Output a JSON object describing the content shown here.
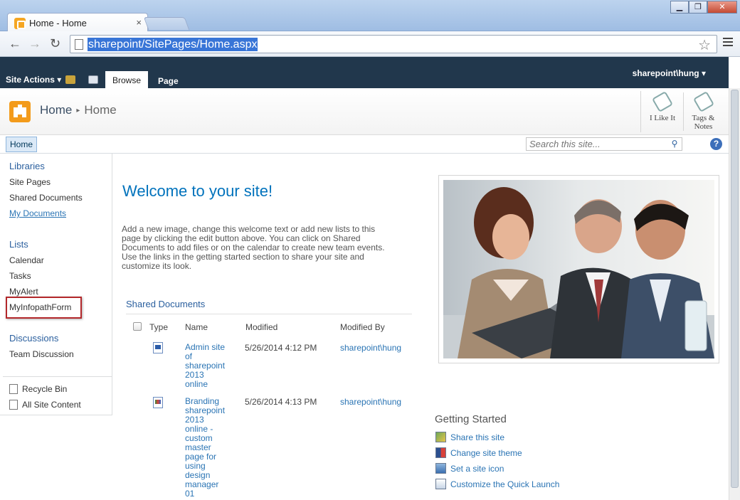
{
  "browser": {
    "tab_title": "Home - Home",
    "tab_close": "×",
    "url": "sharepoint/SitePages/Home.aspx",
    "window_controls": {
      "minimize": "▁",
      "maximize": "❐",
      "close": "✕"
    },
    "nav": {
      "back": "←",
      "forward": "→",
      "reload": "↻",
      "star": "☆"
    }
  },
  "ribbon": {
    "site_actions": "Site Actions ▾",
    "tabs": [
      "Browse",
      "Page"
    ],
    "user": "sharepoint\\hung ▾"
  },
  "title_area": {
    "breadcrumb": [
      "Home",
      "Home"
    ],
    "breadcrumb_sep": "▸",
    "social": {
      "like": "I Like It",
      "tags": "Tags &",
      "tags2": "Notes"
    }
  },
  "topnav": {
    "home": "Home",
    "search_placeholder": "Search this site...",
    "help": "?"
  },
  "quicklaunch": {
    "libraries_header": "Libraries",
    "libraries": [
      "Site Pages",
      "Shared Documents",
      "My Documents"
    ],
    "lists_header": "Lists",
    "lists": [
      "Calendar",
      "Tasks",
      "MyAlert",
      "MyInfopathForm"
    ],
    "discussions_header": "Discussions",
    "discussions": [
      "Team Discussion"
    ],
    "bottom": [
      "Recycle Bin",
      "All Site Content"
    ]
  },
  "main": {
    "welcome_title": "Welcome to your site!",
    "welcome_lines": [
      "Add a new image, change this welcome text or add new lists to this",
      "page by clicking the edit button above. You can click on Shared",
      "Documents to add files or on the calendar to create new team events.",
      "Use the links in the getting started section to share your site and",
      "customize its look."
    ],
    "docs_title": "Shared Documents",
    "columns": [
      "Type",
      "Name",
      "Modified",
      "Modified By"
    ],
    "documents": [
      {
        "name_lines": [
          "Admin site",
          "of",
          "sharepoint",
          "2013",
          "online"
        ],
        "modified": "5/26/2014 4:12 PM",
        "modified_by": "sharepoint\\hung"
      },
      {
        "name_lines": [
          "Branding",
          "sharepoint",
          "2013",
          "online -",
          "custom",
          "master",
          "page for",
          "using",
          "design",
          "manager",
          "01"
        ],
        "modified": "5/26/2014 4:13 PM",
        "modified_by": "sharepoint\\hung"
      }
    ]
  },
  "getting_started": {
    "title": "Getting Started",
    "items": [
      "Share this site",
      "Change site theme",
      "Set a site icon",
      "Customize the Quick Launch"
    ]
  }
}
